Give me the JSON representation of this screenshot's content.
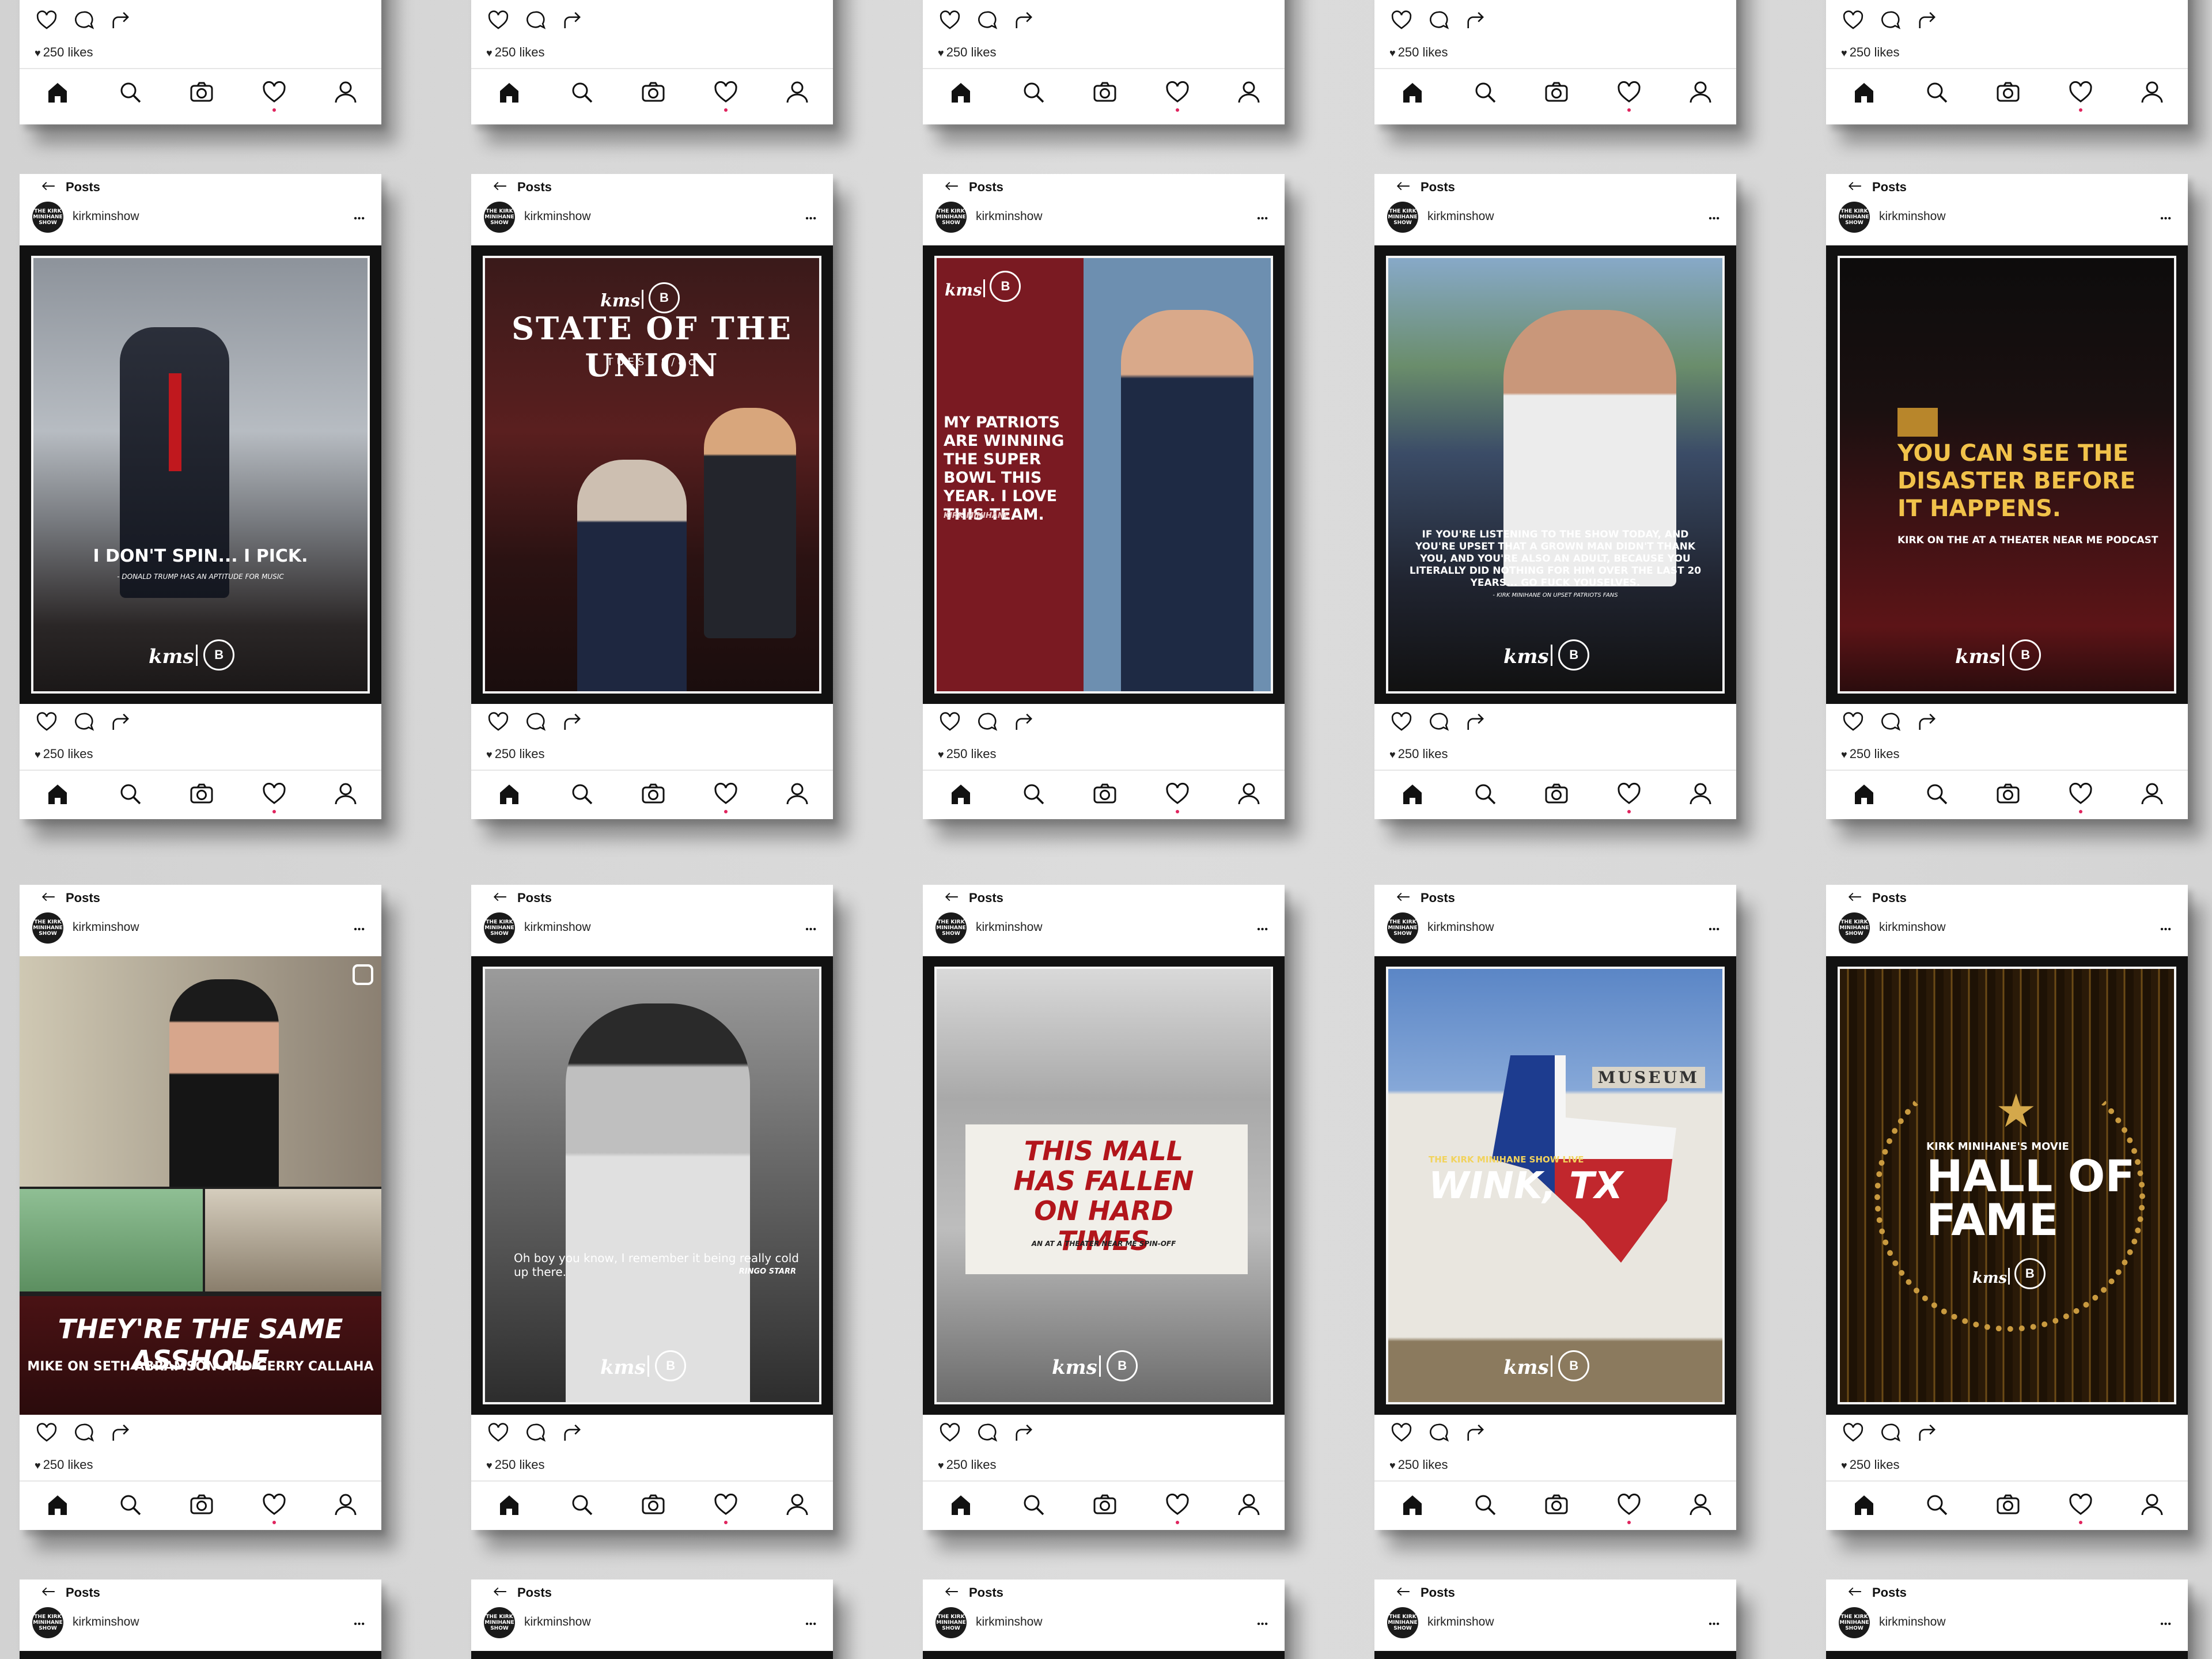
{
  "header": {
    "title": "Posts",
    "username": "kirkminshow",
    "avatar_text": "THE KIRK MINIHANE SHOW"
  },
  "likes_text": "250 likes",
  "posts": [
    {
      "quote": "I DON'T SPIN... I PICK.",
      "attribution": "- DONALD TRUMP HAS AN APTITUDE FOR MUSIC"
    },
    {
      "headline": "STATE OF THE UNION",
      "sub": "TUES. 9/8c"
    },
    {
      "quote": "MY PATRIOTS ARE WINNING THE SUPER BOWL THIS YEAR. I LOVE THIS TEAM.",
      "attribution": "KIRK MINIHANE"
    },
    {
      "quote": "IF YOU'RE LISTENING TO THE SHOW TODAY, AND YOU'RE UPSET THAT A GROWN MAN DIDN'T THANK YOU, AND YOU'RE ALSO AN ADULT, BECAUSE YOU LITERALLY DID NOTHING FOR HIM OVER THE LAST 20 YEARS... GO FUCK YOUSELVES.",
      "attribution": "- KIRK MINIHANE ON UPSET PATRIOTS FANS"
    },
    {
      "quote": "YOU CAN SEE THE DISASTER BEFORE IT HAPPENS.",
      "attribution": "KIRK ON THE AT A THEATER NEAR ME PODCAST"
    },
    {
      "headline": "THEY'RE THE SAME ASSHOLE",
      "sub": "MIKE ON SETH ABRAMSON AND GERRY CALLAHA"
    },
    {
      "quote": "Oh boy you know, I remember it being really cold up there.",
      "attribution": "RINGO STARR"
    },
    {
      "headline": "THIS MALL HAS FALLEN ON HARD TIMES",
      "sub": "AN AT A THEATER NEAR ME SPIN-OFF"
    },
    {
      "headline": "WINK, TX",
      "sub": "THE KIRK MINIHANE SHOW LIVE",
      "sign": "MUSEUM"
    },
    {
      "headline": "HALL OF FAME",
      "sub": "KIRK MINIHANE'S MOVIE"
    }
  ],
  "brand": {
    "logo_text": "kms",
    "badge_text": "B"
  },
  "colors": {
    "notification": "#e0245e",
    "maroon": "#7a1a22",
    "gold": "#c9a14a"
  },
  "icons": [
    "back-arrow-icon",
    "more-icon",
    "heart-icon",
    "comment-icon",
    "share-icon",
    "home-icon",
    "search-icon",
    "camera-icon",
    "activity-icon",
    "profile-icon"
  ]
}
